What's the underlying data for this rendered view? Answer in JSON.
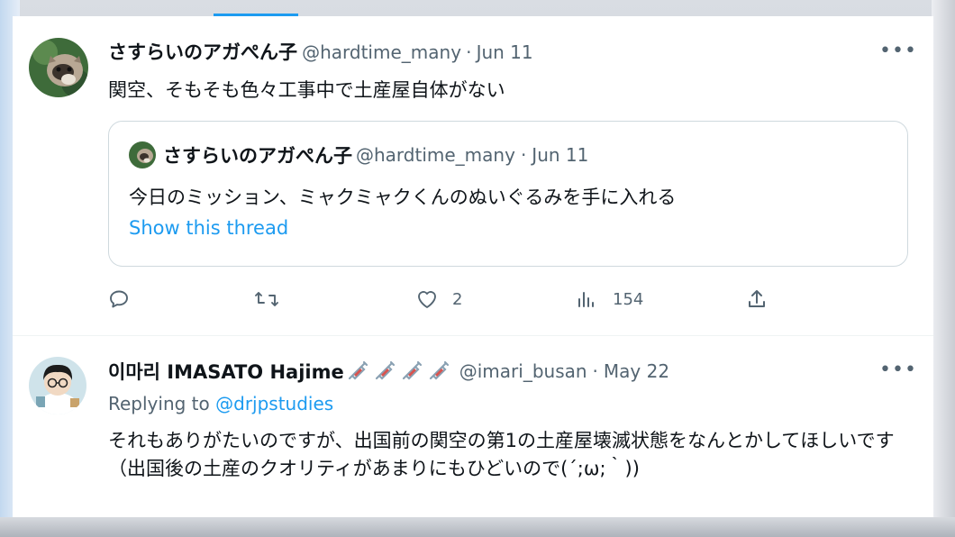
{
  "tweet1": {
    "display_name": "さすらいのアガぺん子",
    "handle": "@hardtime_many",
    "separator": "·",
    "date": "Jun 11",
    "text": "関空、そもそも色々工事中で土産屋自体がない",
    "more_icon": "more-horizontal-icon"
  },
  "quote": {
    "display_name": "さすらいのアガぺん子",
    "handle": "@hardtime_many",
    "separator": "·",
    "date": "Jun 11",
    "text": "今日のミッション、ミャクミャクくんのぬいぐるみを手に入れる",
    "show_thread": "Show this thread"
  },
  "actions": {
    "reply_count": "",
    "retweet_count": "",
    "like_count": "2",
    "views_count": "154"
  },
  "tweet2": {
    "display_name": "이마리 IMASATO Hajime",
    "handle": "@imari_busan",
    "separator": "·",
    "date": "May 22",
    "replying_prefix": "Replying to",
    "replying_mention": "@drjpstudies",
    "text": "それもありがたいのですが、出国前の関空の第1の土産屋壊滅状態をなんとかしてほしいです（出国後の土産のクオリティがあまりにもひどいので(´;ω;｀))"
  },
  "colors": {
    "accent": "#1d9bf0",
    "text": "#0f1419",
    "secondary": "#536471",
    "border": "#cfd9de"
  }
}
